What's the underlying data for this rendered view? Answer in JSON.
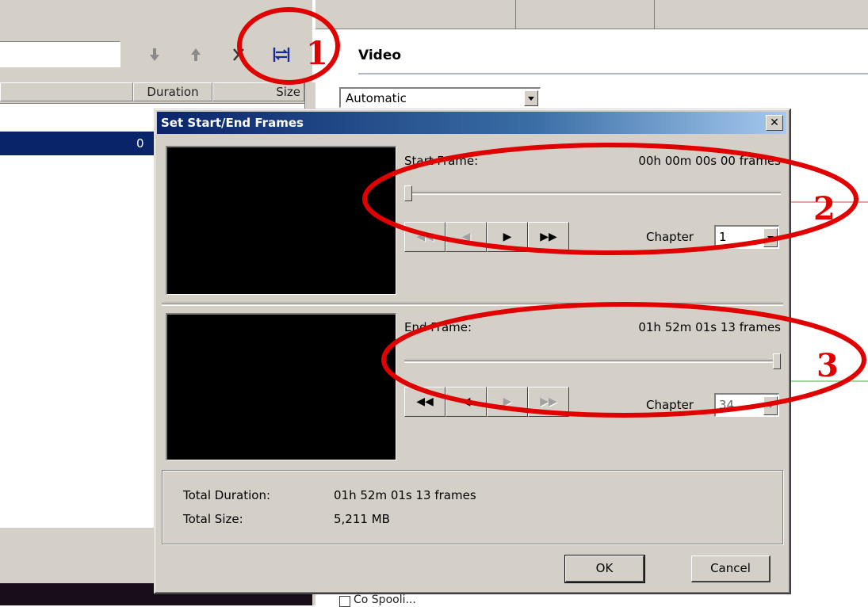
{
  "background": {
    "list_headers": {
      "duration": "Duration",
      "size": "Size"
    },
    "selected_row_text": "0",
    "video_section_title": "Video",
    "encoding_select_value": "Automatic",
    "checkbox_label": "Co Spooli..."
  },
  "dialog": {
    "title": "Set Start/End Frames",
    "start": {
      "label": "Start Frame:",
      "timecode": "00h 00m 00s 00 frames",
      "slider_position": 0.0,
      "chapter_label": "Chapter",
      "chapter_value": "1"
    },
    "end": {
      "label": "End Frame:",
      "timecode": "01h 52m 01s 13 frames",
      "slider_position": 1.0,
      "chapter_label": "Chapter",
      "chapter_value": "34"
    },
    "total_duration_label": "Total Duration:",
    "total_duration_value": "01h 52m 01s 13 frames",
    "total_size_label": "Total Size:",
    "total_size_value": "5,211 MB",
    "ok_label": "OK",
    "cancel_label": "Cancel"
  },
  "annotations": {
    "label_1": "1",
    "label_2": "2",
    "label_3": "3",
    "color": "#e00000"
  },
  "icons": {
    "toolbar": [
      "move-down-icon",
      "move-up-icon",
      "delete-icon",
      "set-start-end-icon"
    ],
    "start_buttons": [
      "rewind-icon",
      "step-back-icon",
      "play-icon",
      "fast-forward-icon"
    ],
    "end_buttons": [
      "rewind-icon",
      "step-back-icon",
      "play-icon",
      "fast-forward-icon"
    ]
  }
}
